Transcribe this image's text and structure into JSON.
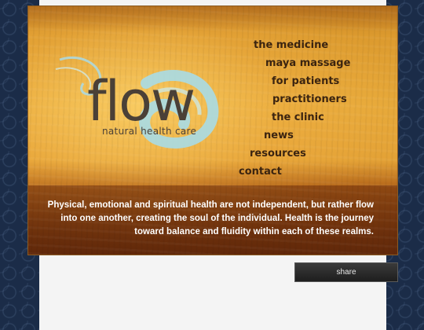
{
  "logo": {
    "word": "flow",
    "tagline": "natural health care"
  },
  "nav": {
    "items": [
      {
        "label": "the medicine"
      },
      {
        "label": "maya massage"
      },
      {
        "label": "for patients"
      },
      {
        "label": "practitioners"
      },
      {
        "label": "the clinic"
      },
      {
        "label": "news"
      },
      {
        "label": "resources"
      },
      {
        "label": "contact"
      }
    ]
  },
  "tagline": "Physical, emotional and spiritual health are not independent, but rather flow into one another, creating the soul of the individual. Health is the journey toward balance and fluidity within each of these realms.",
  "share": {
    "label": "share"
  },
  "colors": {
    "background": "#1b2c48",
    "logo_swirl": "#a9dbe6",
    "nav_text": "#3b2410",
    "share_bg": "#2a2a2a"
  }
}
